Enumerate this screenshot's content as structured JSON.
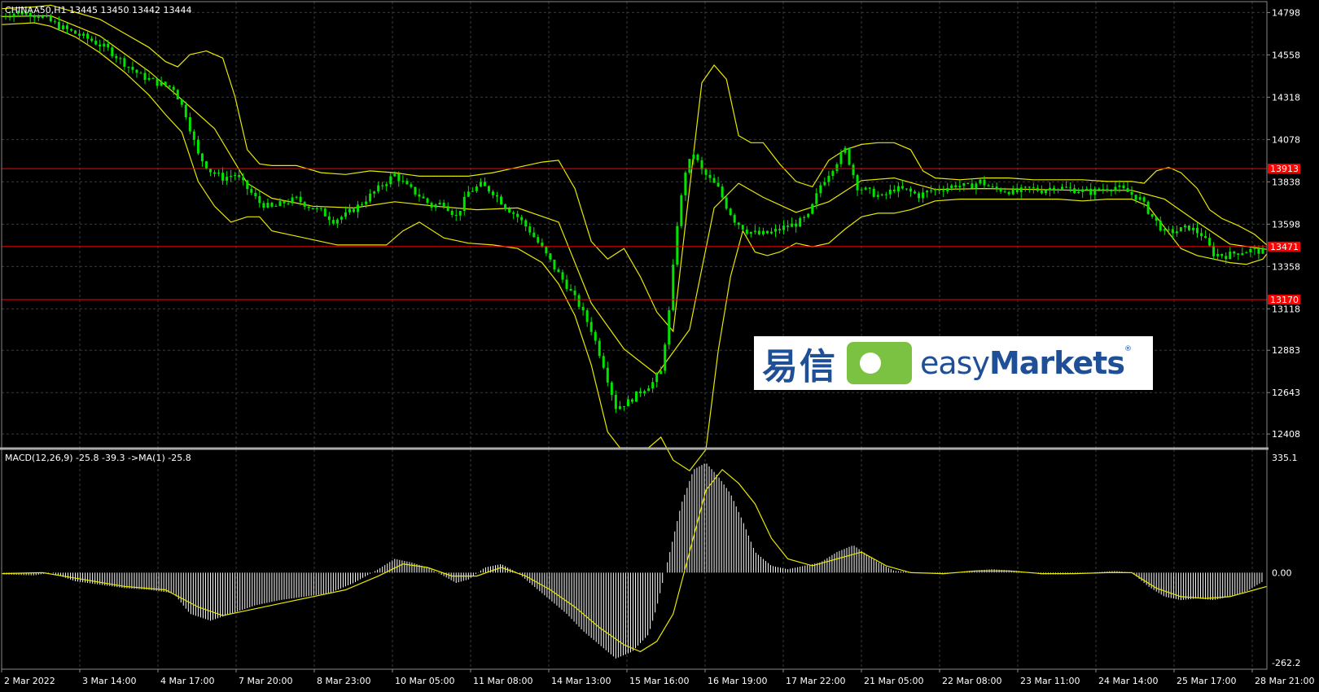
{
  "window": {
    "symbol_label": "CHINAA50,H1  13445 13450 13442 13444"
  },
  "macd": {
    "label": "MACD(12,26,9) -25.8 -39.3  ->MA(1) -25.8",
    "scale_labels": [
      "335.1",
      "0.00",
      "-262.2"
    ],
    "max": 335.1,
    "min": -262.2
  },
  "price_axis": {
    "labels": [
      "14798",
      "14558",
      "14318",
      "14078",
      "13838",
      "13598",
      "13358",
      "13118",
      "12883",
      "12643",
      "12408"
    ],
    "max": 14860,
    "min": 12330
  },
  "levels": [
    {
      "label": "13913",
      "value": 13913,
      "color": "#ff0000"
    },
    {
      "label": "13471",
      "value": 13471,
      "color": "#ff0000"
    },
    {
      "label": "13170",
      "value": 13170,
      "color": "#ff0000"
    }
  ],
  "time_axis": {
    "labels": [
      "2 Mar 2022",
      "3 Mar 14:00",
      "4 Mar 17:00",
      "7 Mar 20:00",
      "8 Mar 23:00",
      "10 Mar 05:00",
      "11 Mar 08:00",
      "14 Mar 13:00",
      "15 Mar 16:00",
      "16 Mar 19:00",
      "17 Mar 22:00",
      "21 Mar 05:00",
      "22 Mar 08:00",
      "23 Mar 11:00",
      "24 Mar 14:00",
      "25 Mar 17:00",
      "28 Mar 21:00"
    ]
  },
  "colors": {
    "background": "#000000",
    "grid": "#3a3a3a",
    "candles": "#00e400",
    "bands": "#e8e800",
    "histogram": "#ffffff",
    "signal": "#e8e800",
    "level": "#ff0000"
  },
  "price_series": [
    [
      0,
      14780
    ],
    [
      20,
      14800
    ],
    [
      40,
      14790
    ],
    [
      55,
      14760
    ],
    [
      70,
      14720
    ],
    [
      90,
      14680
    ],
    [
      110,
      14640
    ],
    [
      130,
      14590
    ],
    [
      150,
      14510
    ],
    [
      170,
      14440
    ],
    [
      190,
      14400
    ],
    [
      210,
      14370
    ],
    [
      225,
      14220
    ],
    [
      240,
      13990
    ],
    [
      255,
      13900
    ],
    [
      270,
      13860
    ],
    [
      285,
      13880
    ],
    [
      300,
      13800
    ],
    [
      315,
      13720
    ],
    [
      330,
      13690
    ],
    [
      345,
      13720
    ],
    [
      360,
      13740
    ],
    [
      375,
      13700
    ],
    [
      390,
      13670
    ],
    [
      405,
      13620
    ],
    [
      420,
      13650
    ],
    [
      435,
      13700
    ],
    [
      450,
      13760
    ],
    [
      465,
      13820
    ],
    [
      480,
      13880
    ],
    [
      495,
      13810
    ],
    [
      510,
      13760
    ],
    [
      525,
      13700
    ],
    [
      540,
      13720
    ],
    [
      555,
      13640
    ],
    [
      570,
      13780
    ],
    [
      585,
      13820
    ],
    [
      600,
      13780
    ],
    [
      615,
      13700
    ],
    [
      630,
      13640
    ],
    [
      645,
      13560
    ],
    [
      660,
      13460
    ],
    [
      675,
      13350
    ],
    [
      690,
      13250
    ],
    [
      705,
      13140
    ],
    [
      720,
      13000
    ],
    [
      735,
      12800
    ],
    [
      750,
      12560
    ],
    [
      765,
      12590
    ],
    [
      780,
      12650
    ],
    [
      795,
      12700
    ],
    [
      805,
      12760
    ],
    [
      815,
      13100
    ],
    [
      825,
      13600
    ],
    [
      835,
      13900
    ],
    [
      845,
      14000
    ],
    [
      855,
      13900
    ],
    [
      865,
      13850
    ],
    [
      875,
      13800
    ],
    [
      885,
      13700
    ],
    [
      895,
      13620
    ],
    [
      910,
      13560
    ],
    [
      925,
      13540
    ],
    [
      940,
      13550
    ],
    [
      955,
      13580
    ],
    [
      970,
      13600
    ],
    [
      985,
      13640
    ],
    [
      1000,
      13820
    ],
    [
      1015,
      13920
    ],
    [
      1030,
      14020
    ],
    [
      1045,
      13810
    ],
    [
      1060,
      13780
    ],
    [
      1075,
      13750
    ],
    [
      1090,
      13800
    ],
    [
      1105,
      13790
    ],
    [
      1120,
      13760
    ],
    [
      1135,
      13790
    ],
    [
      1150,
      13800
    ],
    [
      1165,
      13820
    ],
    [
      1180,
      13810
    ],
    [
      1195,
      13840
    ],
    [
      1210,
      13800
    ],
    [
      1225,
      13790
    ],
    [
      1240,
      13780
    ],
    [
      1255,
      13800
    ],
    [
      1270,
      13790
    ],
    [
      1285,
      13810
    ],
    [
      1300,
      13800
    ],
    [
      1315,
      13790
    ],
    [
      1330,
      13780
    ],
    [
      1345,
      13800
    ],
    [
      1360,
      13810
    ],
    [
      1375,
      13780
    ],
    [
      1390,
      13740
    ],
    [
      1405,
      13640
    ],
    [
      1420,
      13550
    ],
    [
      1435,
      13560
    ],
    [
      1450,
      13580
    ],
    [
      1465,
      13540
    ],
    [
      1480,
      13430
    ],
    [
      1495,
      13420
    ],
    [
      1510,
      13440
    ],
    [
      1525,
      13450
    ],
    [
      1540,
      13444
    ]
  ],
  "upper_band": [
    [
      0,
      14820
    ],
    [
      40,
      14830
    ],
    [
      60,
      14840
    ],
    [
      90,
      14800
    ],
    [
      120,
      14760
    ],
    [
      150,
      14680
    ],
    [
      180,
      14600
    ],
    [
      200,
      14520
    ],
    [
      215,
      14490
    ],
    [
      230,
      14560
    ],
    [
      250,
      14580
    ],
    [
      270,
      14540
    ],
    [
      285,
      14320
    ],
    [
      300,
      14020
    ],
    [
      315,
      13940
    ],
    [
      330,
      13930
    ],
    [
      360,
      13930
    ],
    [
      390,
      13890
    ],
    [
      420,
      13880
    ],
    [
      450,
      13900
    ],
    [
      480,
      13890
    ],
    [
      510,
      13870
    ],
    [
      540,
      13870
    ],
    [
      570,
      13870
    ],
    [
      600,
      13890
    ],
    [
      630,
      13920
    ],
    [
      660,
      13950
    ],
    [
      680,
      13960
    ],
    [
      700,
      13800
    ],
    [
      720,
      13500
    ],
    [
      740,
      13400
    ],
    [
      760,
      13460
    ],
    [
      780,
      13300
    ],
    [
      800,
      13100
    ],
    [
      820,
      12990
    ],
    [
      840,
      13800
    ],
    [
      855,
      14400
    ],
    [
      870,
      14500
    ],
    [
      885,
      14420
    ],
    [
      900,
      14100
    ],
    [
      915,
      14060
    ],
    [
      930,
      14060
    ],
    [
      950,
      13940
    ],
    [
      970,
      13840
    ],
    [
      990,
      13810
    ],
    [
      1010,
      13960
    ],
    [
      1030,
      14020
    ],
    [
      1050,
      14050
    ],
    [
      1070,
      14060
    ],
    [
      1090,
      14060
    ],
    [
      1110,
      14020
    ],
    [
      1125,
      13900
    ],
    [
      1140,
      13860
    ],
    [
      1170,
      13850
    ],
    [
      1200,
      13860
    ],
    [
      1230,
      13860
    ],
    [
      1260,
      13850
    ],
    [
      1290,
      13850
    ],
    [
      1320,
      13850
    ],
    [
      1350,
      13840
    ],
    [
      1380,
      13840
    ],
    [
      1395,
      13830
    ],
    [
      1410,
      13900
    ],
    [
      1425,
      13920
    ],
    [
      1440,
      13890
    ],
    [
      1460,
      13800
    ],
    [
      1475,
      13680
    ],
    [
      1490,
      13630
    ],
    [
      1510,
      13590
    ],
    [
      1530,
      13540
    ],
    [
      1545,
      13480
    ]
  ],
  "lower_band": [
    [
      0,
      14730
    ],
    [
      40,
      14740
    ],
    [
      60,
      14720
    ],
    [
      90,
      14660
    ],
    [
      120,
      14570
    ],
    [
      150,
      14460
    ],
    [
      180,
      14330
    ],
    [
      200,
      14220
    ],
    [
      220,
      14120
    ],
    [
      240,
      13840
    ],
    [
      260,
      13700
    ],
    [
      280,
      13610
    ],
    [
      300,
      13640
    ],
    [
      315,
      13640
    ],
    [
      330,
      13560
    ],
    [
      350,
      13540
    ],
    [
      380,
      13510
    ],
    [
      410,
      13480
    ],
    [
      440,
      13480
    ],
    [
      470,
      13480
    ],
    [
      490,
      13560
    ],
    [
      510,
      13610
    ],
    [
      540,
      13520
    ],
    [
      570,
      13490
    ],
    [
      600,
      13480
    ],
    [
      630,
      13460
    ],
    [
      660,
      13380
    ],
    [
      680,
      13260
    ],
    [
      700,
      13080
    ],
    [
      720,
      12800
    ],
    [
      740,
      12420
    ],
    [
      755,
      12330
    ],
    [
      770,
      12330
    ],
    [
      790,
      12330
    ],
    [
      805,
      12390
    ],
    [
      820,
      12260
    ],
    [
      840,
      12200
    ],
    [
      860,
      12320
    ],
    [
      875,
      12880
    ],
    [
      890,
      13300
    ],
    [
      905,
      13560
    ],
    [
      920,
      13440
    ],
    [
      935,
      13420
    ],
    [
      950,
      13440
    ],
    [
      970,
      13490
    ],
    [
      990,
      13470
    ],
    [
      1010,
      13490
    ],
    [
      1030,
      13570
    ],
    [
      1050,
      13640
    ],
    [
      1070,
      13660
    ],
    [
      1090,
      13660
    ],
    [
      1110,
      13680
    ],
    [
      1140,
      13730
    ],
    [
      1170,
      13740
    ],
    [
      1200,
      13740
    ],
    [
      1230,
      13740
    ],
    [
      1260,
      13740
    ],
    [
      1290,
      13740
    ],
    [
      1320,
      13730
    ],
    [
      1350,
      13740
    ],
    [
      1380,
      13740
    ],
    [
      1400,
      13700
    ],
    [
      1420,
      13580
    ],
    [
      1440,
      13460
    ],
    [
      1460,
      13420
    ],
    [
      1480,
      13400
    ],
    [
      1500,
      13380
    ],
    [
      1520,
      13370
    ],
    [
      1540,
      13400
    ],
    [
      1545,
      13430
    ]
  ],
  "middle_band": [
    [
      0,
      14775
    ],
    [
      60,
      14780
    ],
    [
      120,
      14665
    ],
    [
      180,
      14465
    ],
    [
      220,
      14305
    ],
    [
      260,
      14140
    ],
    [
      300,
      13830
    ],
    [
      330,
      13745
    ],
    [
      380,
      13700
    ],
    [
      430,
      13690
    ],
    [
      480,
      13725
    ],
    [
      530,
      13700
    ],
    [
      580,
      13680
    ],
    [
      630,
      13690
    ],
    [
      680,
      13610
    ],
    [
      720,
      13150
    ],
    [
      760,
      12890
    ],
    [
      800,
      12745
    ],
    [
      840,
      13000
    ],
    [
      870,
      13690
    ],
    [
      900,
      13830
    ],
    [
      930,
      13750
    ],
    [
      970,
      13665
    ],
    [
      1010,
      13725
    ],
    [
      1050,
      13845
    ],
    [
      1090,
      13860
    ],
    [
      1140,
      13795
    ],
    [
      1200,
      13800
    ],
    [
      1260,
      13795
    ],
    [
      1320,
      13790
    ],
    [
      1380,
      13790
    ],
    [
      1420,
      13740
    ],
    [
      1460,
      13610
    ],
    [
      1500,
      13485
    ],
    [
      1545,
      13455
    ]
  ],
  "macd_series": [
    [
      0,
      -5
    ],
    [
      40,
      -8
    ],
    [
      60,
      0
    ],
    [
      90,
      -25
    ],
    [
      120,
      -35
    ],
    [
      150,
      -45
    ],
    [
      180,
      -50
    ],
    [
      210,
      -60
    ],
    [
      230,
      -120
    ],
    [
      255,
      -140
    ],
    [
      280,
      -120
    ],
    [
      310,
      -95
    ],
    [
      340,
      -80
    ],
    [
      370,
      -70
    ],
    [
      400,
      -60
    ],
    [
      430,
      -30
    ],
    [
      460,
      10
    ],
    [
      480,
      40
    ],
    [
      500,
      30
    ],
    [
      520,
      15
    ],
    [
      540,
      -10
    ],
    [
      555,
      -30
    ],
    [
      570,
      -20
    ],
    [
      590,
      15
    ],
    [
      610,
      25
    ],
    [
      630,
      0
    ],
    [
      650,
      -40
    ],
    [
      670,
      -80
    ],
    [
      690,
      -120
    ],
    [
      710,
      -170
    ],
    [
      730,
      -210
    ],
    [
      750,
      -250
    ],
    [
      770,
      -230
    ],
    [
      790,
      -180
    ],
    [
      800,
      -100
    ],
    [
      815,
      50
    ],
    [
      830,
      200
    ],
    [
      845,
      300
    ],
    [
      860,
      320
    ],
    [
      875,
      280
    ],
    [
      890,
      230
    ],
    [
      905,
      150
    ],
    [
      920,
      60
    ],
    [
      940,
      20
    ],
    [
      960,
      10
    ],
    [
      980,
      20
    ],
    [
      1000,
      30
    ],
    [
      1020,
      60
    ],
    [
      1040,
      80
    ],
    [
      1055,
      55
    ],
    [
      1070,
      30
    ],
    [
      1090,
      5
    ],
    [
      1120,
      0
    ],
    [
      1150,
      -5
    ],
    [
      1180,
      5
    ],
    [
      1210,
      10
    ],
    [
      1240,
      5
    ],
    [
      1270,
      -5
    ],
    [
      1300,
      -5
    ],
    [
      1330,
      0
    ],
    [
      1360,
      5
    ],
    [
      1380,
      0
    ],
    [
      1400,
      -40
    ],
    [
      1420,
      -70
    ],
    [
      1440,
      -80
    ],
    [
      1460,
      -75
    ],
    [
      1480,
      -80
    ],
    [
      1500,
      -70
    ],
    [
      1520,
      -55
    ],
    [
      1540,
      -26
    ]
  ],
  "signal_series": [
    [
      0,
      -3
    ],
    [
      50,
      0
    ],
    [
      100,
      -20
    ],
    [
      150,
      -40
    ],
    [
      200,
      -50
    ],
    [
      240,
      -100
    ],
    [
      270,
      -125
    ],
    [
      300,
      -110
    ],
    [
      340,
      -90
    ],
    [
      380,
      -70
    ],
    [
      420,
      -50
    ],
    [
      460,
      -10
    ],
    [
      490,
      25
    ],
    [
      520,
      15
    ],
    [
      550,
      -10
    ],
    [
      580,
      -10
    ],
    [
      610,
      15
    ],
    [
      640,
      -10
    ],
    [
      670,
      -50
    ],
    [
      700,
      -100
    ],
    [
      730,
      -160
    ],
    [
      760,
      -210
    ],
    [
      780,
      -230
    ],
    [
      800,
      -200
    ],
    [
      820,
      -120
    ],
    [
      840,
      60
    ],
    [
      860,
      240
    ],
    [
      880,
      300
    ],
    [
      900,
      260
    ],
    [
      920,
      200
    ],
    [
      940,
      100
    ],
    [
      960,
      40
    ],
    [
      990,
      20
    ],
    [
      1020,
      40
    ],
    [
      1050,
      60
    ],
    [
      1080,
      20
    ],
    [
      1110,
      0
    ],
    [
      1150,
      -3
    ],
    [
      1190,
      5
    ],
    [
      1230,
      5
    ],
    [
      1270,
      -3
    ],
    [
      1310,
      -3
    ],
    [
      1350,
      0
    ],
    [
      1380,
      0
    ],
    [
      1410,
      -45
    ],
    [
      1440,
      -70
    ],
    [
      1470,
      -75
    ],
    [
      1500,
      -70
    ],
    [
      1530,
      -50
    ],
    [
      1545,
      -40
    ]
  ]
}
